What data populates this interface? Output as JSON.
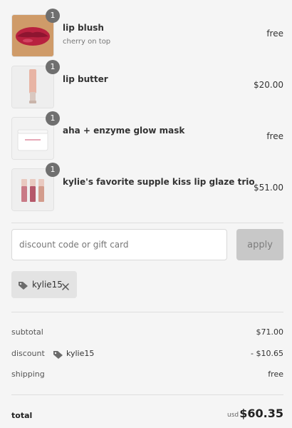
{
  "items": [
    {
      "name": "lip blush",
      "variant": "cherry on top",
      "price": "free",
      "quantity": "1",
      "image": "red-lips-photo"
    },
    {
      "name": "lip butter",
      "variant": "",
      "price": "$20.00",
      "quantity": "1",
      "image": "lip-butter-tube"
    },
    {
      "name": "aha + enzyme glow mask",
      "variant": "",
      "price": "free",
      "quantity": "1",
      "image": "glow-mask-jar"
    },
    {
      "name": "kylie's favorite supple kiss lip glaze trio",
      "variant": "",
      "price": "$51.00",
      "quantity": "1",
      "image": "lip-glaze-trio"
    }
  ],
  "discount": {
    "placeholder": "discount code or gift card",
    "apply_label": "apply",
    "applied_code": "kylie15"
  },
  "summary": {
    "subtotal_label": "subtotal",
    "subtotal_value": "$71.00",
    "discount_label": "discount",
    "discount_code": "kylie15",
    "discount_value": "- $10.65",
    "shipping_label": "shipping",
    "shipping_value": "free"
  },
  "total": {
    "label": "total",
    "currency": "usd",
    "amount": "$60.35"
  }
}
